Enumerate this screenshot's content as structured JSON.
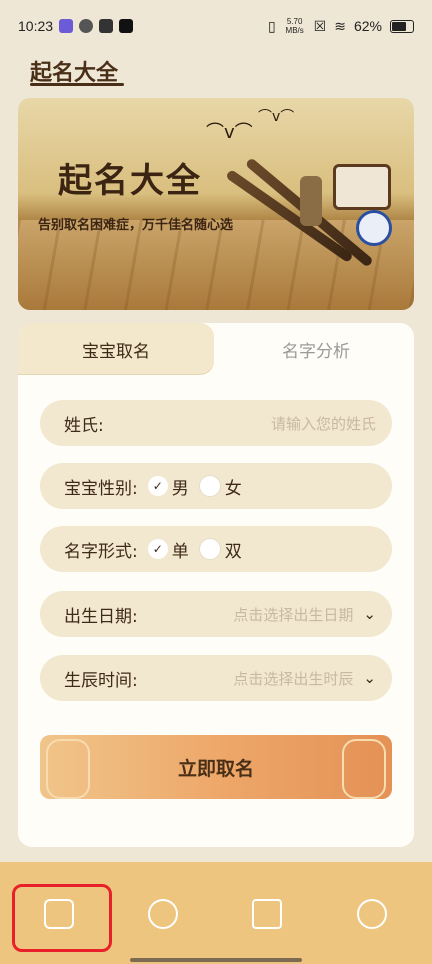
{
  "status": {
    "time": "10:23",
    "net_speed": "5.70 MB/s",
    "battery": "62%"
  },
  "brand": {
    "title": "起名大全"
  },
  "banner": {
    "calligraphy": "起名大全",
    "subtitle": "告别取名困难症，万千佳名随心选"
  },
  "tabs": [
    {
      "label": "宝宝取名",
      "active": true
    },
    {
      "label": "名字分析",
      "active": false
    }
  ],
  "form": {
    "surname": {
      "label": "姓氏:",
      "placeholder": "请输入您的姓氏"
    },
    "gender": {
      "label": "宝宝性别:",
      "options": [
        "男",
        "女"
      ],
      "selected": "男"
    },
    "name_form": {
      "label": "名字形式:",
      "options": [
        "单",
        "双"
      ],
      "selected": "单"
    },
    "birth_date": {
      "label": "出生日期:",
      "placeholder": "点击选择出生日期"
    },
    "birth_time": {
      "label": "生辰时间:",
      "placeholder": "点击选择出生时辰"
    }
  },
  "submit_label": "立即取名",
  "nav": {
    "items": [
      "naming-icon",
      "analysis-icon",
      "calendar-icon",
      "profile-icon"
    ]
  },
  "colors": {
    "nav": "#edc57f",
    "highlight": "#e8202a",
    "button": "#eea86a"
  }
}
